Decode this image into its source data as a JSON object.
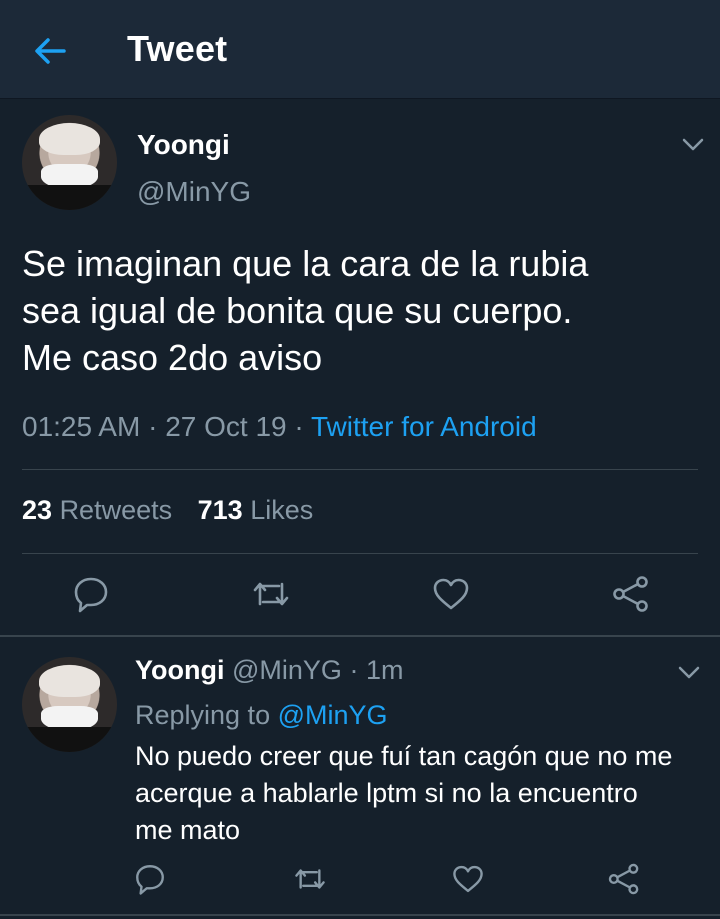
{
  "header": {
    "title": "Tweet",
    "back_icon": "arrow-left-icon"
  },
  "colors": {
    "accent": "#1da1f2",
    "background": "#15202b",
    "muted": "#8899a6"
  },
  "main_tweet": {
    "name": "Yoongi",
    "handle": "@MinYG",
    "text_lines": [
      "Se imaginan que la cara de la rubia",
      "sea igual de bonita que su cuerpo.",
      "Me caso 2do aviso"
    ],
    "time": "01:25 AM",
    "dot1": "·",
    "date": "27 Oct 19",
    "dot2": "·",
    "source": "Twitter for Android",
    "retweets_count": "23",
    "retweets_label": "Retweets",
    "likes_count": "713",
    "likes_label": "Likes"
  },
  "reply_tweet": {
    "name": "Yoongi",
    "handle": "@MinYG",
    "dot": "·",
    "time": "1m",
    "replying_label": "Replying to",
    "replying_handle": "@MinYG",
    "text_lines": [
      "No puedo creer que fuí tan cagón que no me",
      "acerque a hablarle lptm si no la encuentro",
      "me mato"
    ]
  },
  "action_icons": [
    "reply-icon",
    "retweet-icon",
    "like-icon",
    "share-icon"
  ]
}
